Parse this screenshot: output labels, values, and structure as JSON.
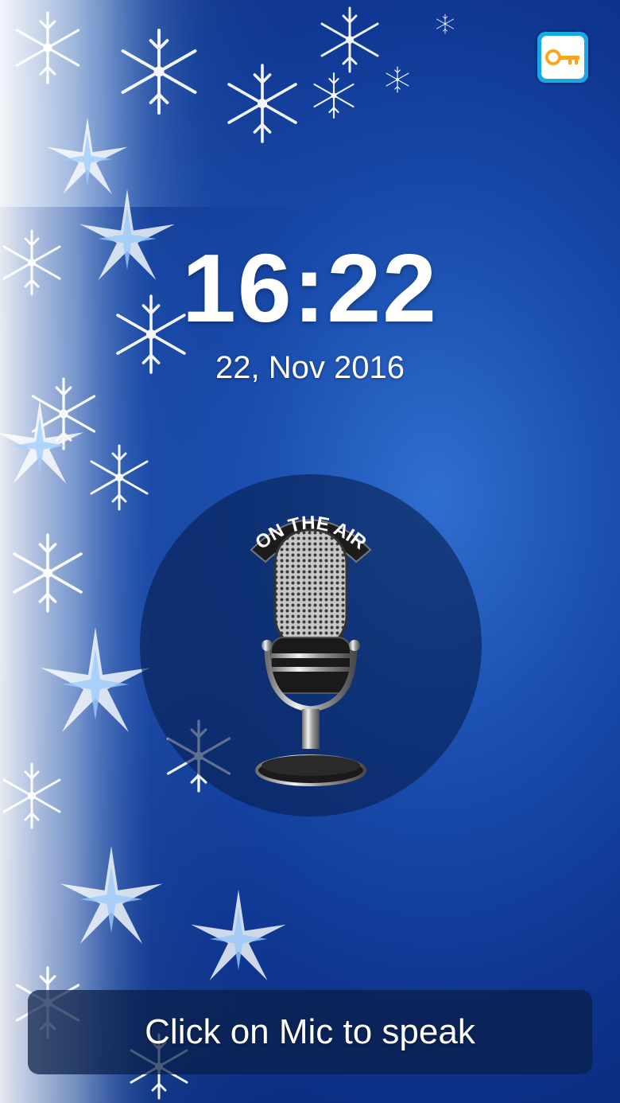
{
  "lock_screen": {
    "time": "16:22",
    "date": "22, Nov 2016",
    "prompt": "Click on Mic to speak",
    "mic_badge": "ON THE AIR",
    "key_icon": "key-icon",
    "mic_icon": "microphone-icon"
  },
  "colors": {
    "background": "#0e3590",
    "key_button_border": "#1aa7e6",
    "key_color": "#f5a623",
    "text": "#ffffff"
  }
}
